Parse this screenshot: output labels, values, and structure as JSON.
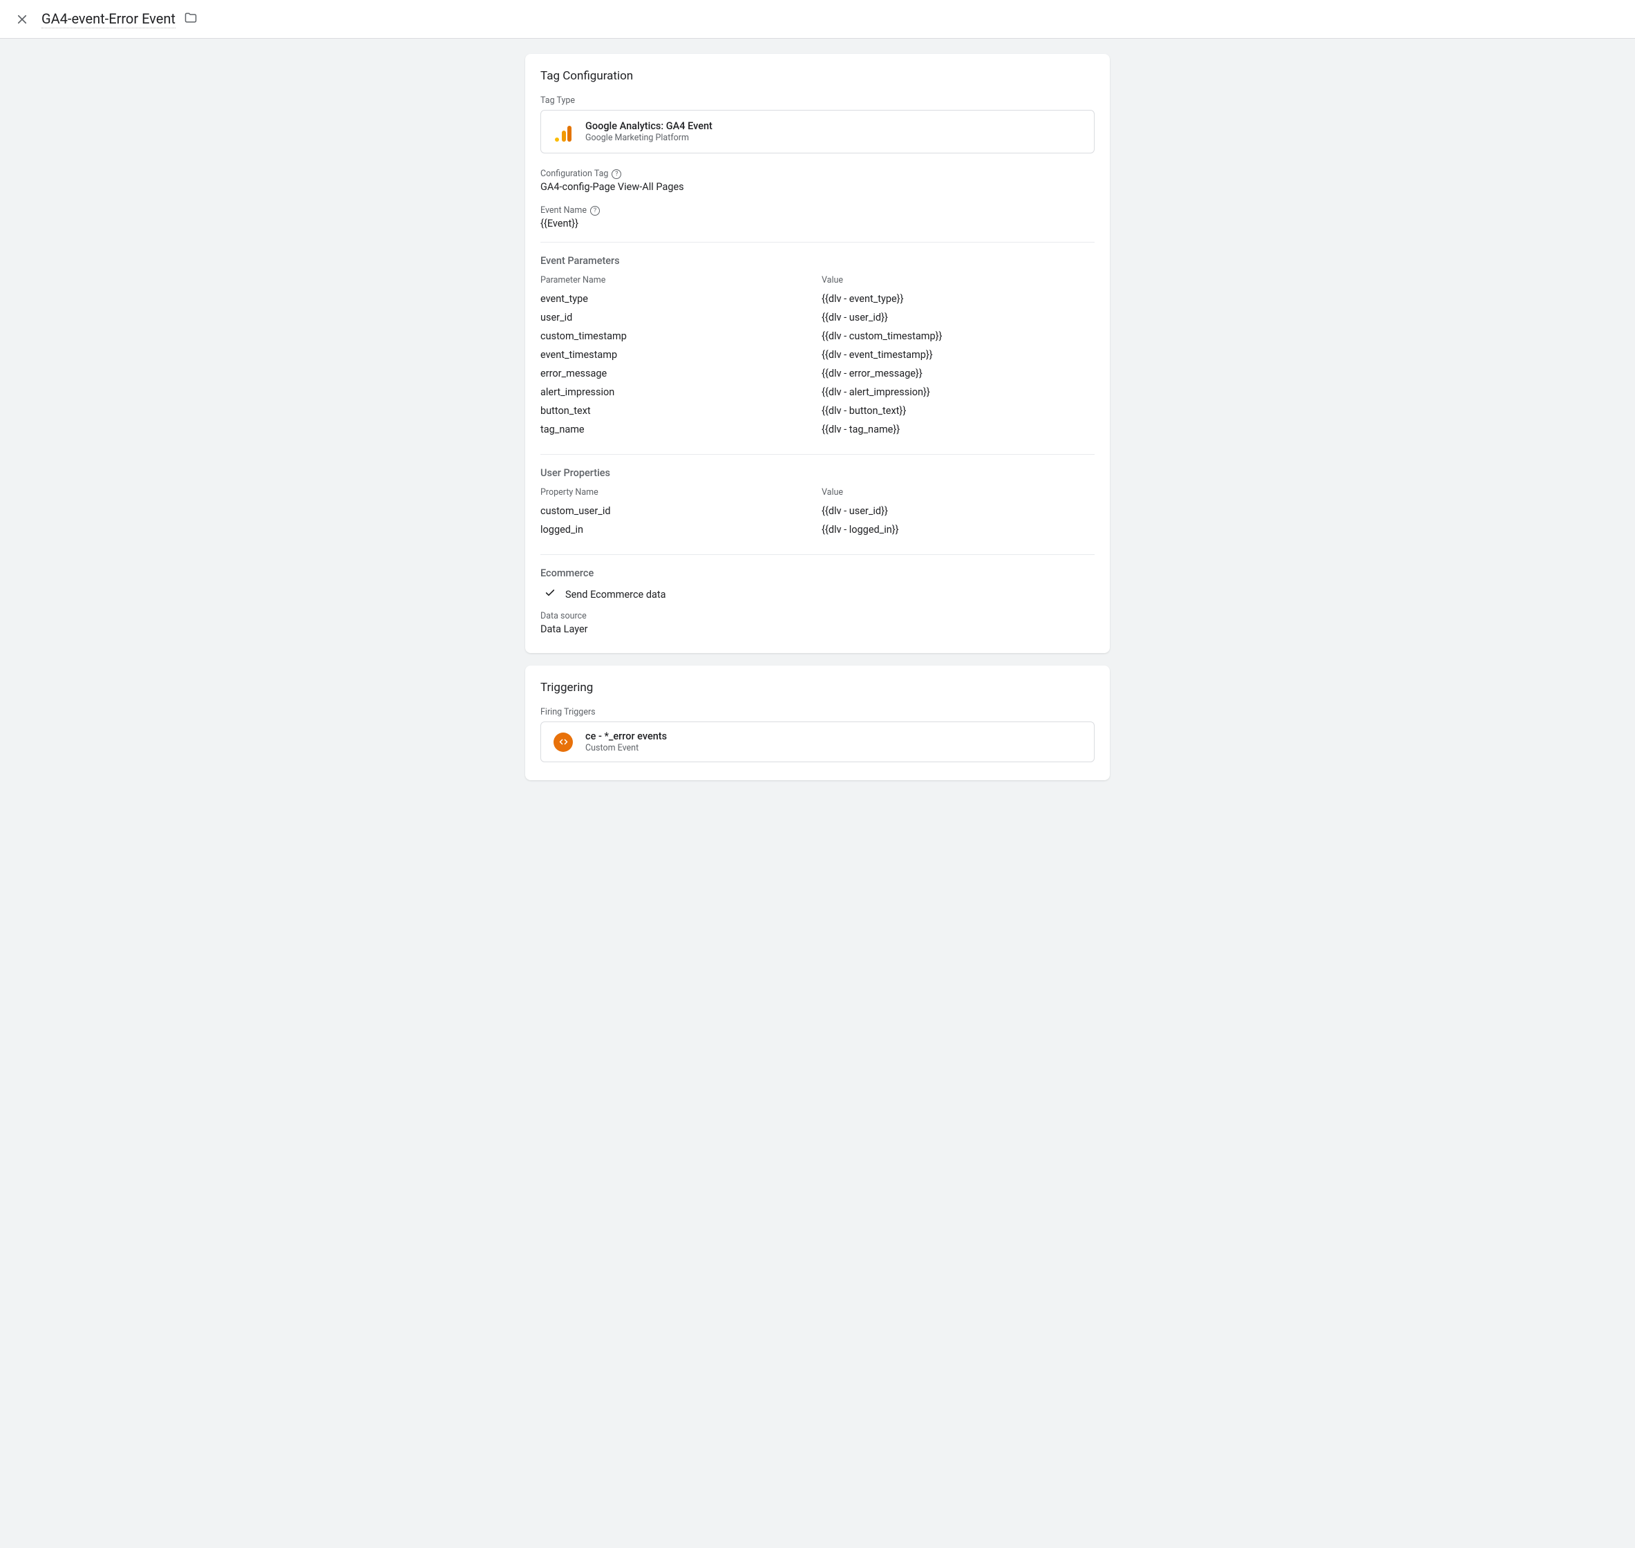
{
  "header": {
    "tag_name": "GA4-event-Error Event"
  },
  "tag_config": {
    "title": "Tag Configuration",
    "tag_type_label": "Tag Type",
    "tag_type_name": "Google Analytics: GA4 Event",
    "tag_type_sub": "Google Marketing Platform",
    "config_tag_label": "Configuration Tag",
    "config_tag_value": "GA4-config-Page View-All Pages",
    "event_name_label": "Event Name",
    "event_name_value": "{{Event}}",
    "event_params": {
      "title": "Event Parameters",
      "name_header": "Parameter Name",
      "value_header": "Value",
      "rows": [
        {
          "name": "event_type",
          "value": "{{dlv - event_type}}"
        },
        {
          "name": "user_id",
          "value": "{{dlv - user_id}}"
        },
        {
          "name": "custom_timestamp",
          "value": "{{dlv - custom_timestamp}}"
        },
        {
          "name": "event_timestamp",
          "value": "{{dlv - event_timestamp}}"
        },
        {
          "name": "error_message",
          "value": "{{dlv - error_message}}"
        },
        {
          "name": "alert_impression",
          "value": "{{dlv - alert_impression}}"
        },
        {
          "name": "button_text",
          "value": "{{dlv - button_text}}"
        },
        {
          "name": "tag_name",
          "value": "{{dlv - tag_name}}"
        }
      ]
    },
    "user_props": {
      "title": "User Properties",
      "name_header": "Property Name",
      "value_header": "Value",
      "rows": [
        {
          "name": "custom_user_id",
          "value": "{{dlv - user_id}}"
        },
        {
          "name": "logged_in",
          "value": "{{dlv - logged_in}}"
        }
      ]
    },
    "ecommerce": {
      "title": "Ecommerce",
      "send_label": "Send Ecommerce data",
      "data_source_label": "Data source",
      "data_source_value": "Data Layer"
    }
  },
  "triggering": {
    "title": "Triggering",
    "firing_label": "Firing Triggers",
    "trigger_name": "ce - *_error events",
    "trigger_type": "Custom Event"
  }
}
